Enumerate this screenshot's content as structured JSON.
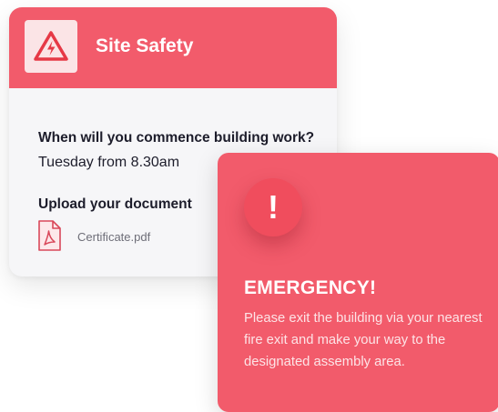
{
  "site_card": {
    "title": "Site Safety",
    "header_icon": "high-voltage-warning-icon",
    "question": "When will you commence building work?",
    "answer": "Tuesday from 8.30am",
    "upload_label": "Upload your document",
    "file": {
      "icon": "pdf-file-icon",
      "name": "Certificate.pdf"
    }
  },
  "emergency_card": {
    "alert_icon": "exclamation-icon",
    "alert_glyph": "!",
    "title": "EMERGENCY!",
    "message": "Please exit the building via your nearest fire exit and make your way to the designated assembly area."
  },
  "colors": {
    "accent": "#f25b6b",
    "icon_tile": "#fbe4e6",
    "warning_stroke": "#e63946",
    "text_dark": "#1d1d2b",
    "text_muted": "#6e6e78"
  }
}
